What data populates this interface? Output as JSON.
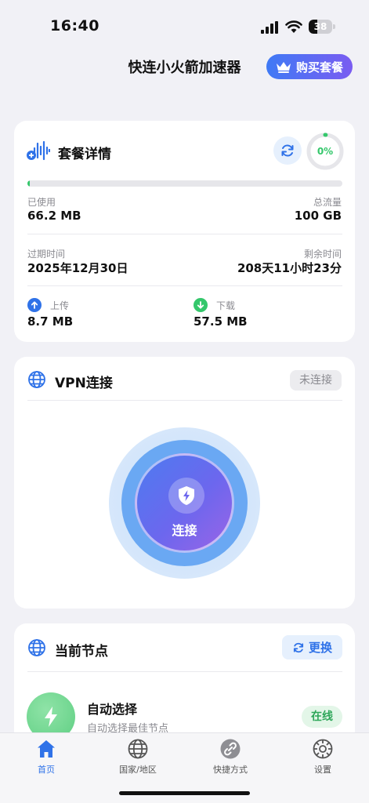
{
  "status_bar": {
    "time": "16:40",
    "battery_level": "38",
    "battery_fraction": 0.38,
    "icons": [
      "signal-icon",
      "wifi-icon",
      "battery-icon"
    ]
  },
  "header": {
    "title": "快连小火箭加速器",
    "buy_label": "购买套餐",
    "buy_icon": "crown-icon"
  },
  "plan": {
    "title": "套餐详情",
    "percent_label": "0%",
    "usage_fraction": 0.0066,
    "used_label": "已使用",
    "used_value": "66.2 MB",
    "total_label": "总流量",
    "total_value": "100 GB",
    "expire_label": "过期时间",
    "expire_value": "2025年12月30日",
    "remain_label": "剩余时间",
    "remain_value": "208天11小时23分",
    "upload_label": "上传",
    "upload_value": "8.7 MB",
    "download_label": "下载",
    "download_value": "57.5 MB"
  },
  "vpn": {
    "title": "VPN连接",
    "status": "未连接",
    "connect_label": "连接"
  },
  "node": {
    "title": "当前节点",
    "change_label": "更换",
    "name": "自动选择",
    "desc": "自动选择最佳节点",
    "status": "在线"
  },
  "tabs": [
    {
      "label": "首页",
      "icon": "home-icon",
      "active": true
    },
    {
      "label": "国家/地区",
      "icon": "globe-icon",
      "active": false
    },
    {
      "label": "快捷方式",
      "icon": "link-icon",
      "active": false
    },
    {
      "label": "设置",
      "icon": "settings-icon",
      "active": false
    }
  ],
  "colors": {
    "accent": "#2f72e8",
    "green": "#34c76b",
    "background": "#f1f1f6"
  }
}
